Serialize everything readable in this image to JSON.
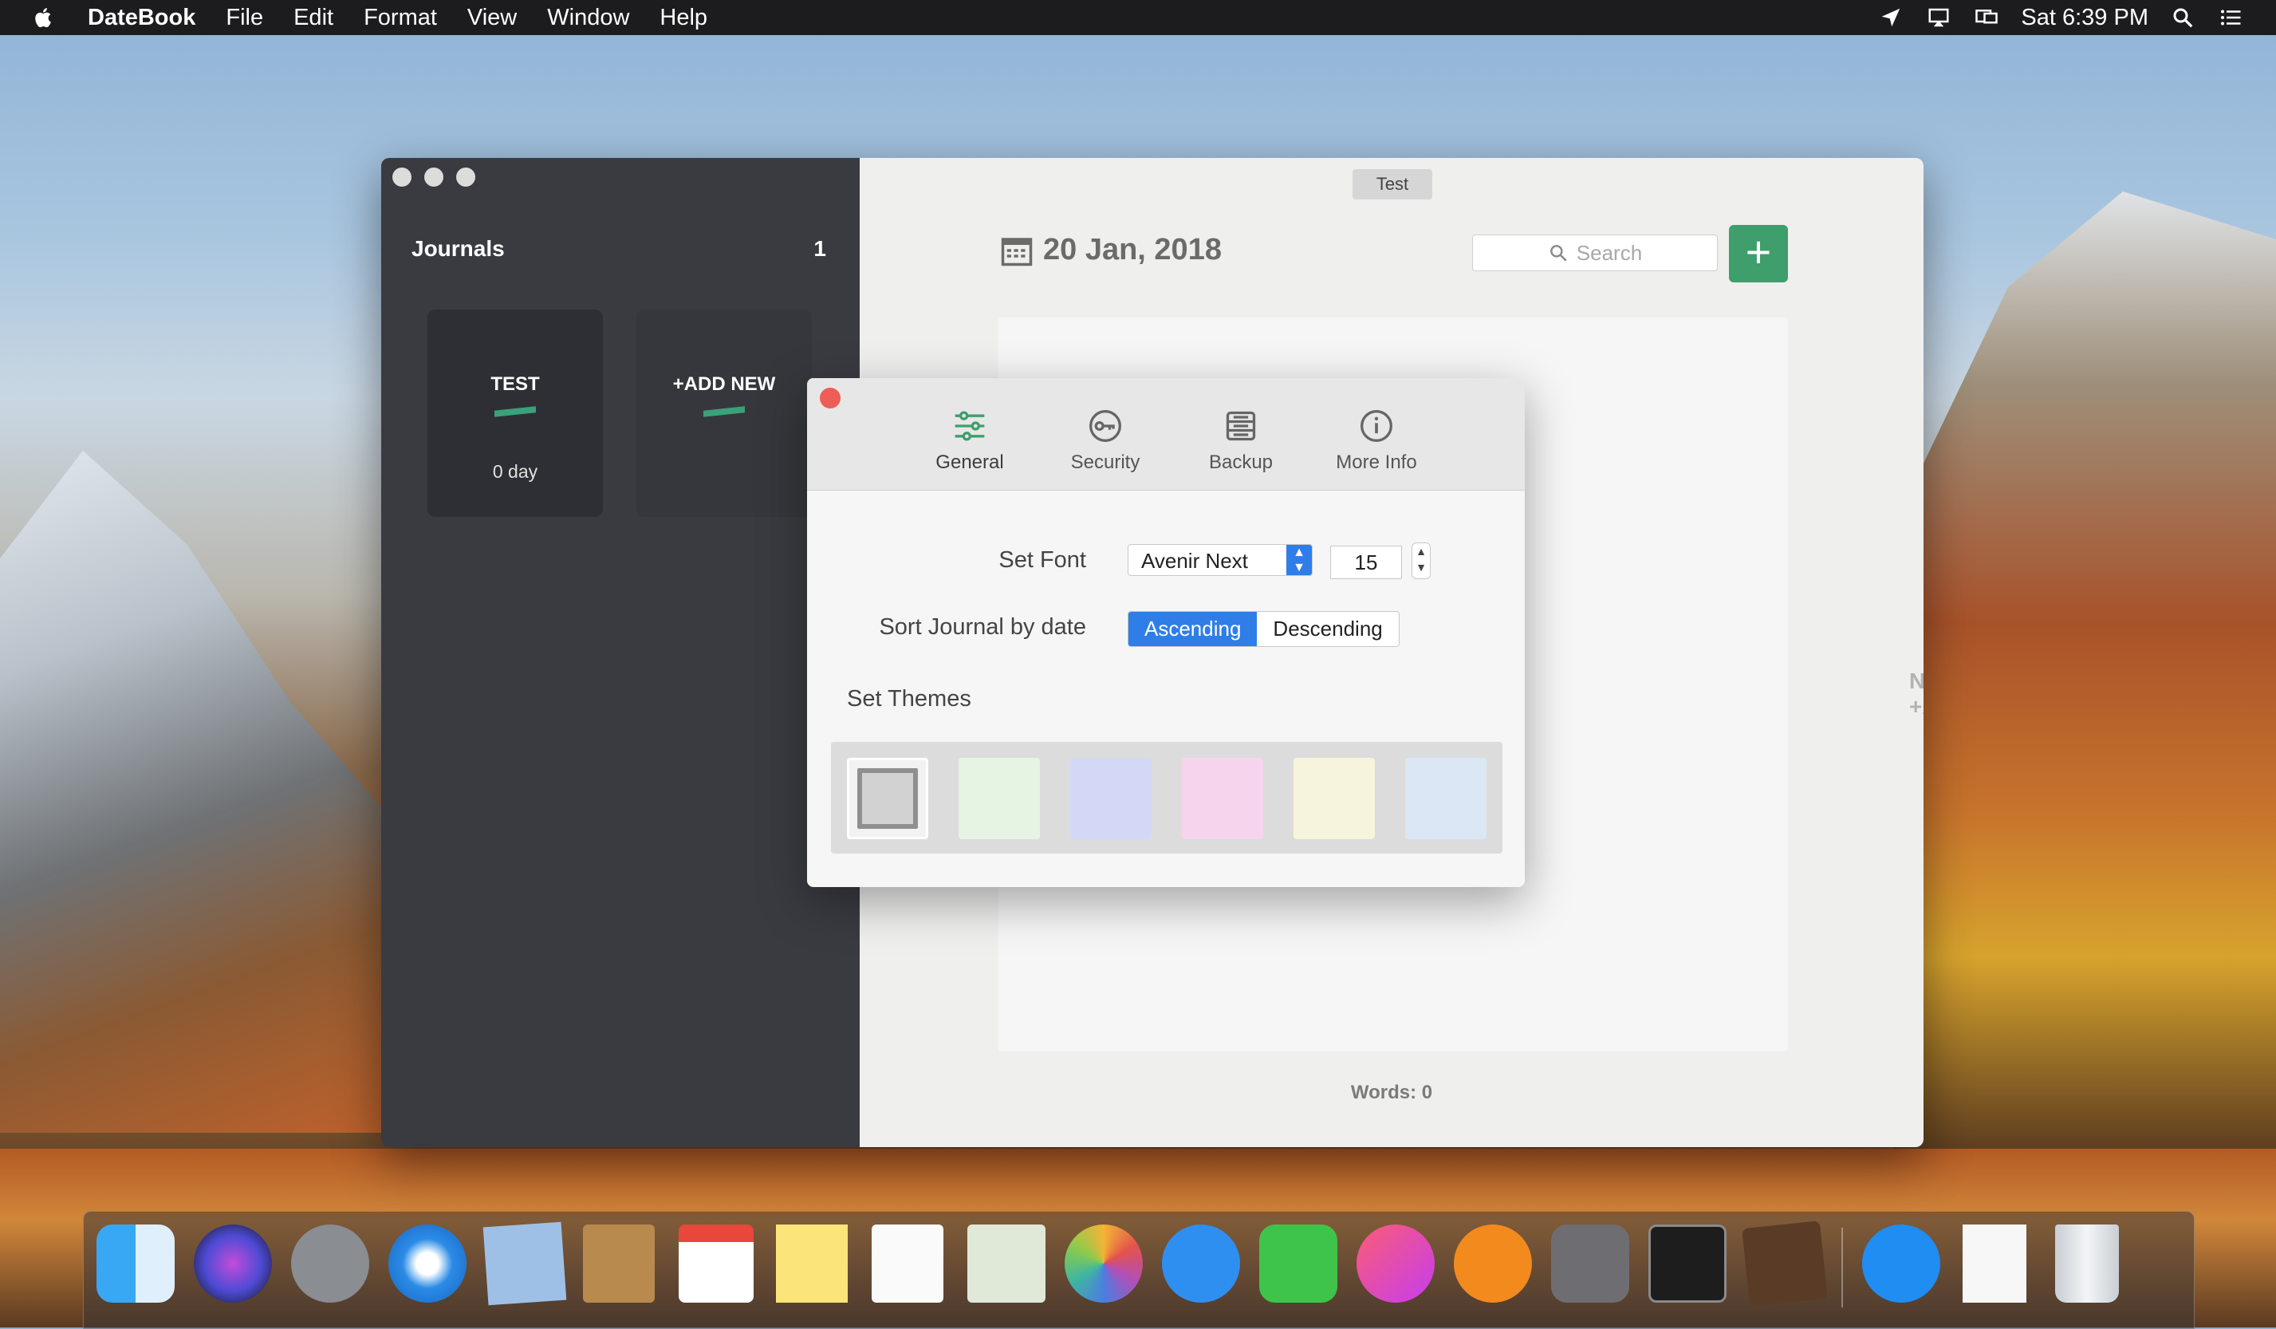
{
  "menubar": {
    "app_name": "DateBook",
    "items": [
      "File",
      "Edit",
      "Format",
      "View",
      "Window",
      "Help"
    ],
    "clock": "Sat 6:39 PM"
  },
  "sidebar": {
    "title": "Journals",
    "count": "1",
    "cards": [
      {
        "name": "TEST",
        "days": "0 day"
      },
      {
        "name": "+ADD NEW",
        "days": ""
      }
    ]
  },
  "main": {
    "tab_label": "Test",
    "date": "20 Jan, 2018",
    "search_placeholder": "Search",
    "add_label": "+",
    "hint": "N) to +Add",
    "words": "Words: 0"
  },
  "prefs": {
    "tabs": [
      "General",
      "Security",
      "Backup",
      "More Info"
    ],
    "active_tab": "General",
    "font_label": "Set Font",
    "font_value": "Avenir Next",
    "font_size": "15",
    "sort_label": "Sort Journal by date",
    "sort_options": [
      "Ascending",
      "Descending"
    ],
    "sort_selected": "Ascending",
    "themes_label": "Set Themes",
    "theme_colors": [
      "#d2d2d2",
      "#e6f4e4",
      "#d3d8f6",
      "#f6d4ee",
      "#f7f4dd",
      "#dbe7f5"
    ]
  },
  "colors": {
    "accent_green": "#3e9e6c",
    "accent_blue": "#2f7ee8"
  }
}
